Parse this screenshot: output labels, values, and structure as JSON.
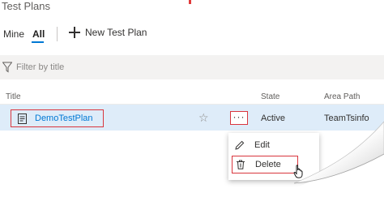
{
  "page": {
    "title": "Test Plans"
  },
  "tabs": [
    {
      "label": "Mine",
      "selected": false
    },
    {
      "label": "All",
      "selected": true
    }
  ],
  "toolbar": {
    "new_plan_label": "New Test Plan",
    "new_plan_icon": "plus-icon"
  },
  "filter": {
    "placeholder": "Filter by title",
    "icon": "funnel-icon"
  },
  "table": {
    "columns": [
      "Title",
      "State",
      "Area Path"
    ],
    "rows": [
      {
        "title": "DemoTestPlan",
        "state": "Active",
        "area_path": "TeamTsinfo",
        "favorited": false,
        "more_label": "···"
      }
    ]
  },
  "context_menu": {
    "items": [
      {
        "label": "Edit",
        "icon": "pencil-icon"
      },
      {
        "label": "Delete",
        "icon": "trash-icon"
      }
    ]
  },
  "colors": {
    "accent": "#0078d4",
    "highlight_border": "#d9363e",
    "row_selected": "#deecf9",
    "filter_background": "#f3f2f1"
  }
}
